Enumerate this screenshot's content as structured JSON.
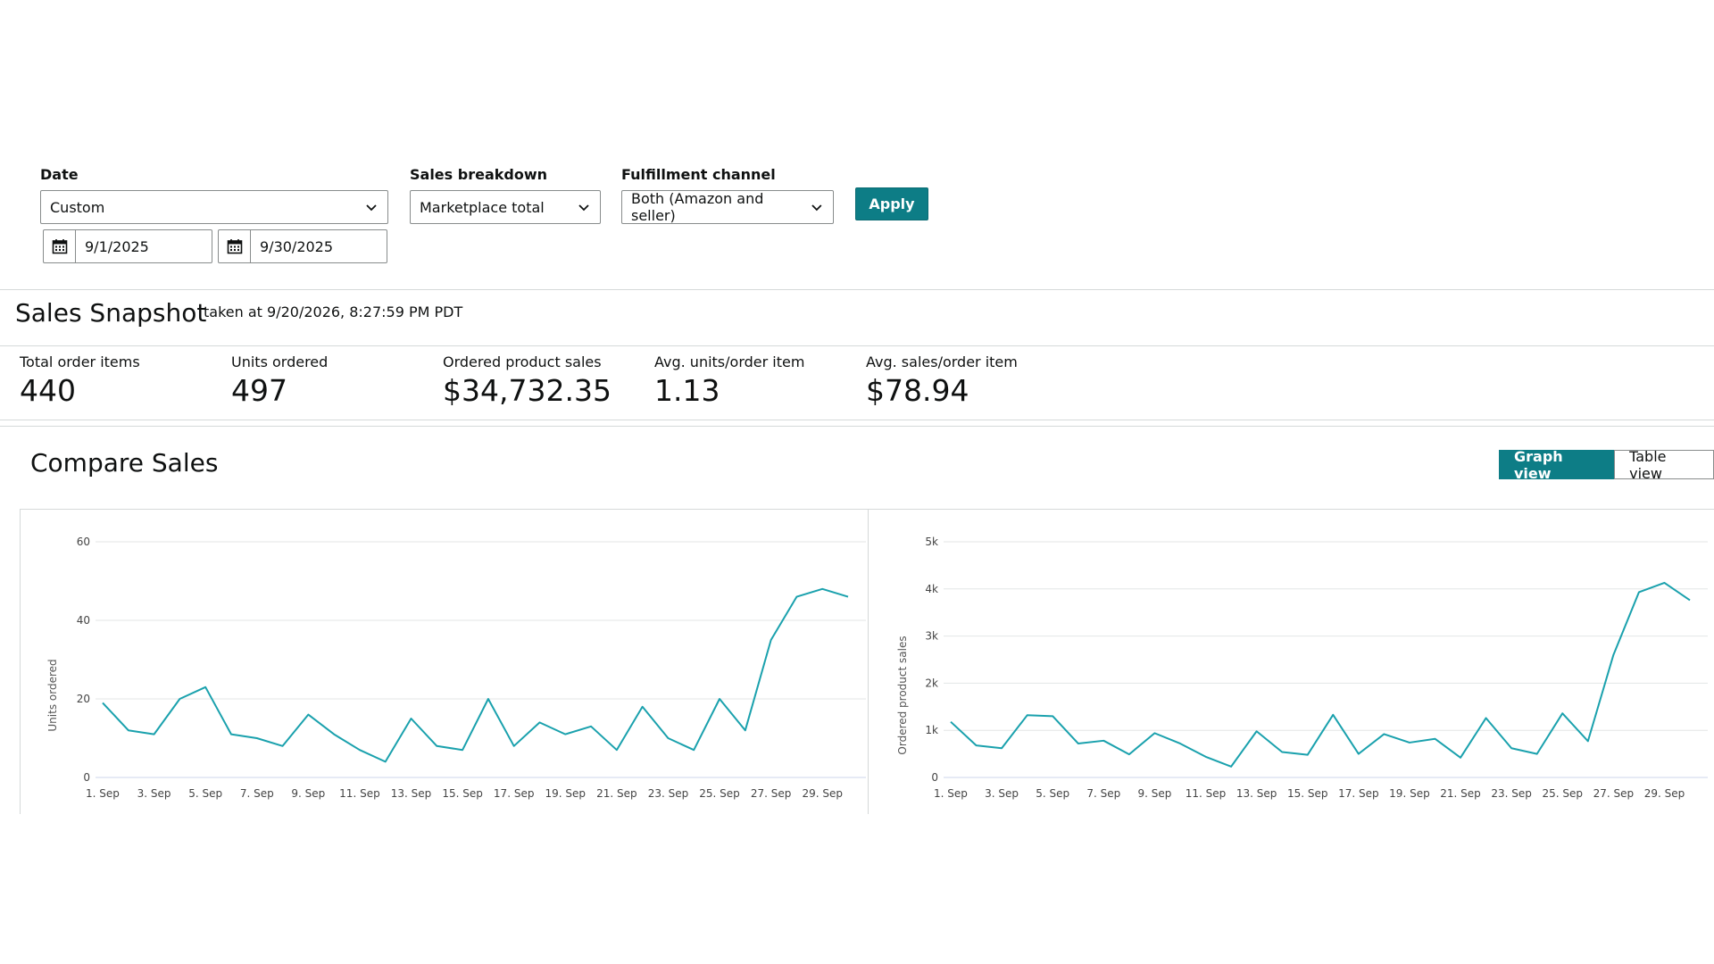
{
  "filters": {
    "date": {
      "label": "Date",
      "selected": "Custom",
      "start": "9/1/2025",
      "end": "9/30/2025"
    },
    "sales_breakdown": {
      "label": "Sales breakdown",
      "selected": "Marketplace total"
    },
    "fulfillment": {
      "label": "Fulfillment channel",
      "selected": "Both (Amazon and seller)"
    },
    "apply_label": "Apply"
  },
  "snapshot": {
    "title": "Sales Snapshot",
    "taken_at": "taken at 9/20/2026, 8:27:59 PM PDT",
    "metrics": [
      {
        "label": "Total order items",
        "value": "440"
      },
      {
        "label": "Units ordered",
        "value": "497"
      },
      {
        "label": "Ordered product sales",
        "value": "$34,732.35"
      },
      {
        "label": "Avg. units/order item",
        "value": "1.13"
      },
      {
        "label": "Avg. sales/order item",
        "value": "$78.94"
      }
    ]
  },
  "compare": {
    "title": "Compare Sales",
    "views": {
      "graph": "Graph view",
      "table": "Table view",
      "active": "graph"
    }
  },
  "colors": {
    "accent": "#0d7d86",
    "line": "#1aa1ad",
    "grid": "#e3e6e6"
  },
  "chart_data": [
    {
      "type": "line",
      "title": "",
      "xlabel": "",
      "ylabel": "Units ordered",
      "ylim": [
        0,
        60
      ],
      "yticks": [
        0,
        20,
        40,
        60
      ],
      "ytick_labels": [
        "0",
        "20",
        "40",
        "60"
      ],
      "xtick_labels": [
        "1. Sep",
        "3. Sep",
        "5. Sep",
        "7. Sep",
        "9. Sep",
        "11. Sep",
        "13. Sep",
        "15. Sep",
        "17. Sep",
        "19. Sep",
        "21. Sep",
        "23. Sep",
        "25. Sep",
        "27. Sep",
        "29. Sep"
      ],
      "x": [
        1,
        2,
        3,
        4,
        5,
        6,
        7,
        8,
        9,
        10,
        11,
        12,
        13,
        14,
        15,
        16,
        17,
        18,
        19,
        20,
        21,
        22,
        23,
        24,
        25,
        26,
        27,
        28,
        29,
        30
      ],
      "values": [
        19,
        12,
        11,
        20,
        23,
        11,
        10,
        8,
        16,
        11,
        7,
        4,
        15,
        8,
        7,
        20,
        8,
        14,
        11,
        13,
        7,
        18,
        10,
        7,
        20,
        12,
        35,
        46,
        48,
        46
      ],
      "grid": true
    },
    {
      "type": "line",
      "title": "",
      "xlabel": "",
      "ylabel": "Ordered product sales",
      "ylim": [
        0,
        5000
      ],
      "yticks": [
        0,
        1000,
        2000,
        3000,
        4000,
        5000
      ],
      "ytick_labels": [
        "0",
        "1k",
        "2k",
        "3k",
        "4k",
        "5k"
      ],
      "xtick_labels": [
        "1. Sep",
        "3. Sep",
        "5. Sep",
        "7. Sep",
        "9. Sep",
        "11. Sep",
        "13. Sep",
        "15. Sep",
        "17. Sep",
        "19. Sep",
        "21. Sep",
        "23. Sep",
        "25. Sep",
        "27. Sep",
        "29. Sep"
      ],
      "x": [
        1,
        2,
        3,
        4,
        5,
        6,
        7,
        8,
        9,
        10,
        11,
        12,
        13,
        14,
        15,
        16,
        17,
        18,
        19,
        20,
        21,
        22,
        23,
        24,
        25,
        26,
        27,
        28,
        29,
        30
      ],
      "values": [
        1180,
        680,
        620,
        1320,
        1300,
        720,
        780,
        490,
        940,
        720,
        440,
        230,
        980,
        540,
        480,
        1330,
        500,
        920,
        740,
        820,
        420,
        1260,
        620,
        500,
        1360,
        770,
        2600,
        3930,
        4130,
        3760
      ],
      "grid": true
    }
  ]
}
